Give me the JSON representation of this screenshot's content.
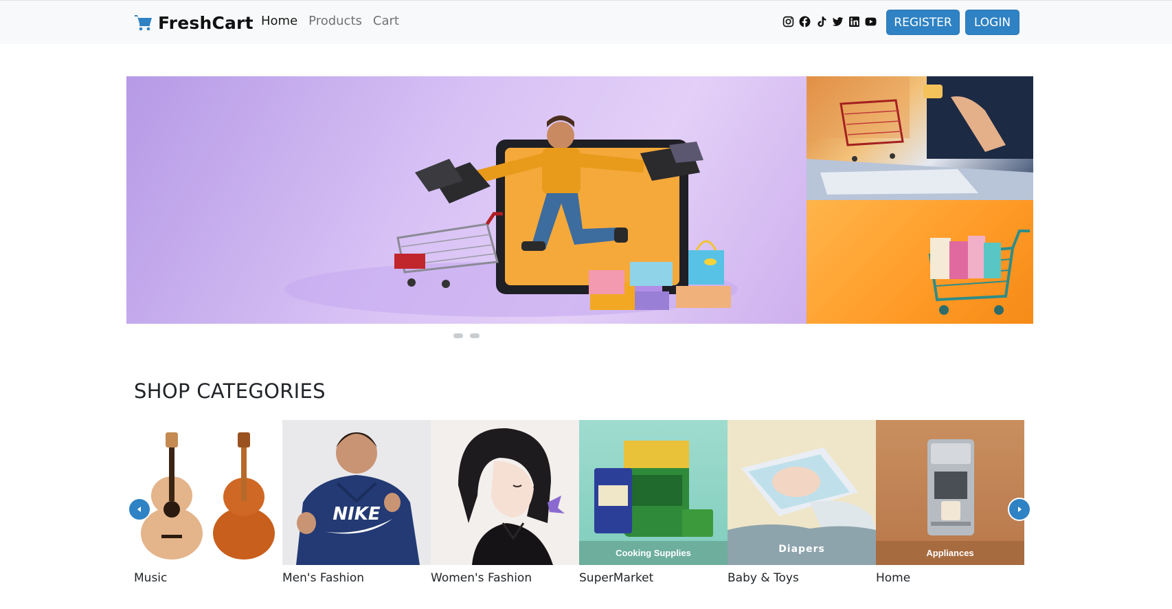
{
  "brand": {
    "name": "FreshCart",
    "color": "#2f82c3"
  },
  "nav": {
    "links": [
      {
        "label": "Home",
        "active": true
      },
      {
        "label": "Products",
        "active": false
      },
      {
        "label": "Cart",
        "active": false
      }
    ]
  },
  "socials": [
    "instagram-icon",
    "facebook-icon",
    "tiktok-icon",
    "twitter-icon",
    "linkedin-icon",
    "youtube-icon"
  ],
  "auth": {
    "register_label": "REGISTER",
    "login_label": "LOGIN",
    "button_color": "#2f82c3"
  },
  "hero": {
    "slides_count": 2
  },
  "categories_section": {
    "title": "SHOP CATEGORIES",
    "items": [
      {
        "name": "Music",
        "overlay": ""
      },
      {
        "name": "Men's Fashion",
        "overlay": "NIKE"
      },
      {
        "name": "Women's Fashion",
        "overlay": ""
      },
      {
        "name": "SuperMarket",
        "overlay": "Cooking Supplies"
      },
      {
        "name": "Baby & Toys",
        "overlay": "Diapers"
      },
      {
        "name": "Home",
        "overlay": "Appliances"
      }
    ]
  }
}
